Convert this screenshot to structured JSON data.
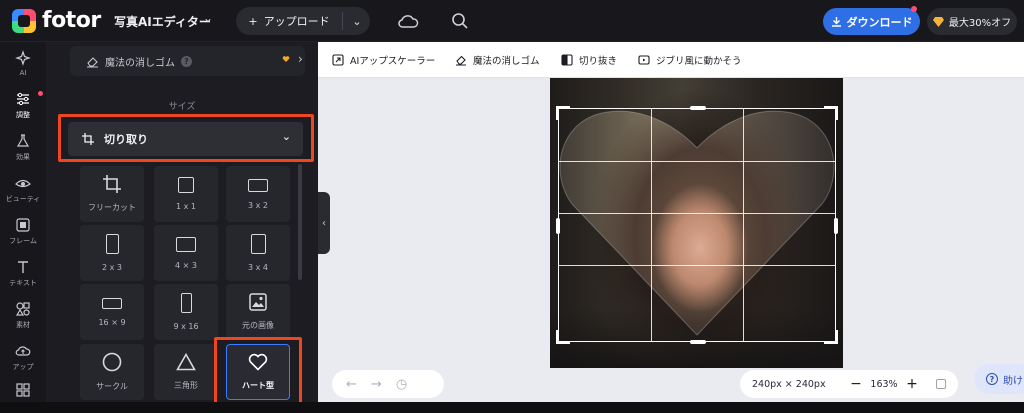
{
  "header": {
    "brand": "fotor",
    "doc_title": "写真AIエディター",
    "upload_label": "アップロード",
    "download_label": "ダウンロード",
    "promo_label": "最大30%オフ"
  },
  "rail": {
    "items": [
      {
        "label": "AI"
      },
      {
        "label": "調整"
      },
      {
        "label": "効果"
      },
      {
        "label": "ビューティ"
      },
      {
        "label": "フレーム"
      },
      {
        "label": "テキスト"
      },
      {
        "label": "素材"
      },
      {
        "label": "アップ"
      }
    ]
  },
  "panel": {
    "eraser_label": "魔法の消しゴム",
    "section_label": "サイズ",
    "crop_select_label": "切り取り",
    "ratios": [
      {
        "label": "フリーカット"
      },
      {
        "label": "1 x 1"
      },
      {
        "label": "3 x 2"
      },
      {
        "label": "2 x 3"
      },
      {
        "label": "4 × 3"
      },
      {
        "label": "3 x 4"
      },
      {
        "label": "16 × 9"
      },
      {
        "label": "9 x 16"
      },
      {
        "label": "元の画像"
      },
      {
        "label": "サークル"
      },
      {
        "label": "三角形"
      },
      {
        "label": "ハート型"
      }
    ],
    "selected_ratio": "ハート型"
  },
  "toolbar": {
    "tools": [
      {
        "label": "AIアップスケーラー"
      },
      {
        "label": "魔法の消しゴム"
      },
      {
        "label": "切り抜き"
      },
      {
        "label": "ジブリ風に動かそう"
      }
    ]
  },
  "canvas": {
    "size_label": "240px × 240px",
    "zoom_level": "163%",
    "help_label": "助け"
  },
  "colors": {
    "accent_blue": "#2f6fe6",
    "highlight_orange": "#f0461d",
    "selected_border": "#3a7bff"
  }
}
